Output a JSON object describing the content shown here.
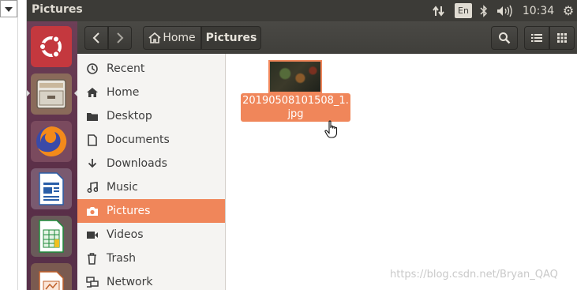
{
  "window": {
    "title": "Pictures"
  },
  "top_panel": {
    "lang_indicator": "En",
    "clock": "10:34"
  },
  "launcher": {
    "items": [
      {
        "name": "ubuntu-dash-icon"
      },
      {
        "name": "files-icon"
      },
      {
        "name": "firefox-icon"
      },
      {
        "name": "libreoffice-writer-icon"
      },
      {
        "name": "libreoffice-calc-icon"
      },
      {
        "name": "libreoffice-impress-icon"
      }
    ]
  },
  "headerbar": {
    "path": [
      {
        "label": "Home"
      },
      {
        "label": "Pictures"
      }
    ]
  },
  "sidebar": {
    "items": [
      {
        "label": "Recent",
        "icon": "clock-icon",
        "active": false
      },
      {
        "label": "Home",
        "icon": "home-icon",
        "active": false
      },
      {
        "label": "Desktop",
        "icon": "folder-icon",
        "active": false
      },
      {
        "label": "Documents",
        "icon": "document-icon",
        "active": false
      },
      {
        "label": "Downloads",
        "icon": "download-icon",
        "active": false
      },
      {
        "label": "Music",
        "icon": "music-icon",
        "active": false
      },
      {
        "label": "Pictures",
        "icon": "camera-icon",
        "active": true
      },
      {
        "label": "Videos",
        "icon": "video-icon",
        "active": false
      },
      {
        "label": "Trash",
        "icon": "trash-icon",
        "active": false
      },
      {
        "label": "Network",
        "icon": "network-icon",
        "active": false
      }
    ]
  },
  "content": {
    "files": [
      {
        "name_line1": "20190508101508_1.",
        "name_line2": "jpg",
        "selected": true
      }
    ]
  },
  "watermark": "https://blog.csdn.net/Bryan_QAQ",
  "colors": {
    "accent": "#f0865a",
    "panel": "#3c3b37",
    "launcher": "#5a2e47"
  }
}
